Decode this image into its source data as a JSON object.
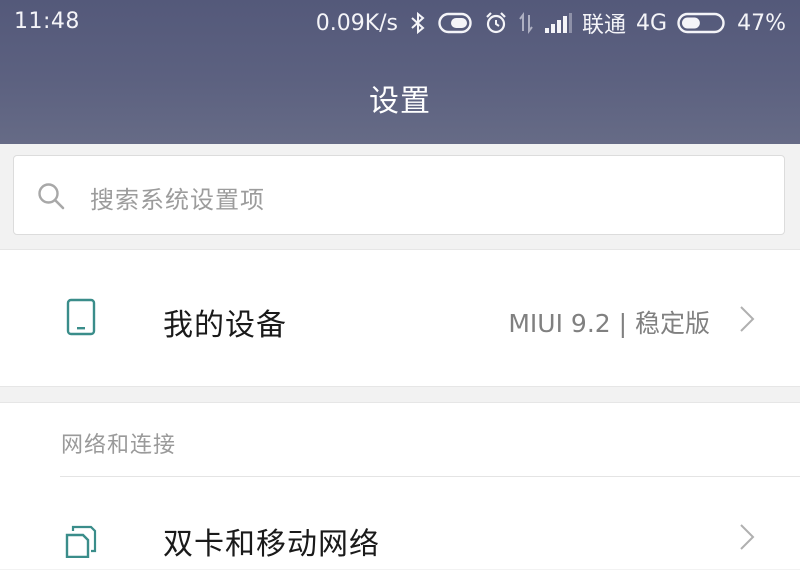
{
  "status_bar": {
    "time": "11:48",
    "net_speed": "0.09K/s",
    "carrier": "联通",
    "network_type": "4G",
    "battery": "47%",
    "battery_level": 0.47,
    "icons": [
      "bluetooth-icon",
      "toggle-icon",
      "alarm-icon",
      "data-arrows-icon",
      "signal-icon",
      "battery-icon"
    ]
  },
  "header": {
    "title": "设置",
    "background": "#5c6180"
  },
  "search": {
    "placeholder": "搜索系统设置项",
    "icon": "search-icon"
  },
  "device": {
    "title": "我的设备",
    "value": "MIUI 9.2 | 稳定版",
    "icon": "phone-icon",
    "accent": "#3a8d8a"
  },
  "network_section": {
    "label": "网络和连接",
    "items": [
      {
        "title": "双卡和移动网络",
        "icon": "dual-sim-icon"
      }
    ]
  }
}
